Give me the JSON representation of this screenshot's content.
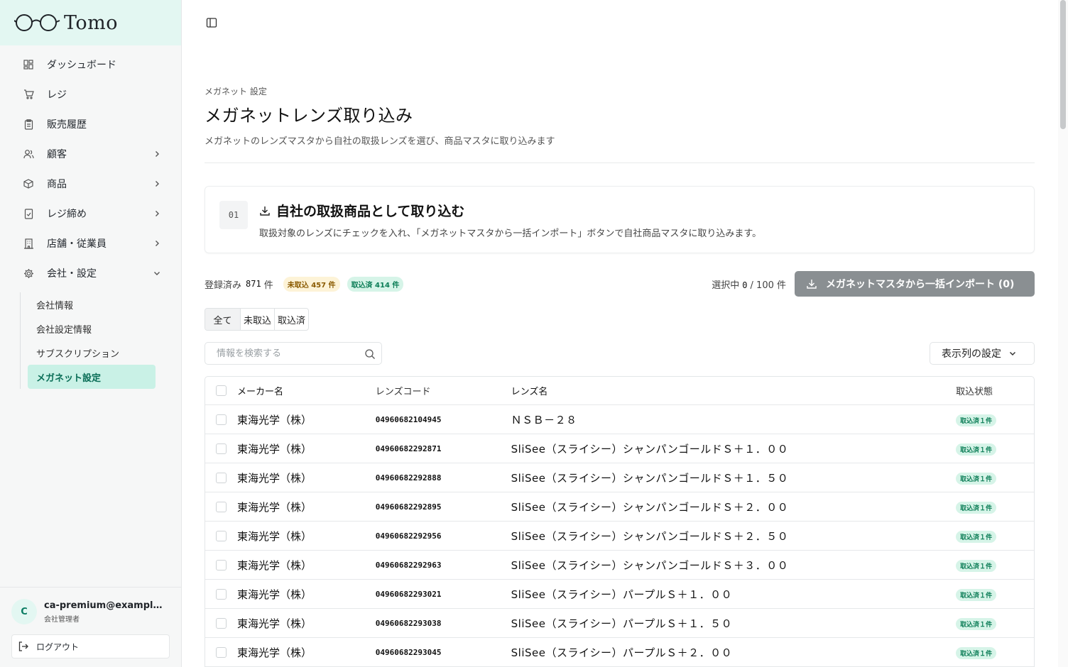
{
  "brand": {
    "name": "Tomo"
  },
  "sidebar": {
    "items": [
      {
        "label": "ダッシュボード",
        "icon": "dashboard-icon",
        "chevron": ""
      },
      {
        "label": "レジ",
        "icon": "cart-icon",
        "chevron": ""
      },
      {
        "label": "販売履歴",
        "icon": "receipt-icon",
        "chevron": ""
      },
      {
        "label": "顧客",
        "icon": "users-icon",
        "chevron": "right"
      },
      {
        "label": "商品",
        "icon": "box-icon",
        "chevron": "right"
      },
      {
        "label": "レジ締め",
        "icon": "register-close-icon",
        "chevron": "right"
      },
      {
        "label": "店舗・従業員",
        "icon": "store-icon",
        "chevron": "right"
      },
      {
        "label": "会社・設定",
        "icon": "gear-icon",
        "chevron": "down"
      }
    ],
    "subitems": [
      {
        "label": "会社情報",
        "active": false
      },
      {
        "label": "会社設定情報",
        "active": false
      },
      {
        "label": "サブスクリプション",
        "active": false
      },
      {
        "label": "メガネット設定",
        "active": true
      }
    ],
    "user": {
      "initial": "C",
      "email": "ca-premium@example.com",
      "role": "会社管理者"
    },
    "logout_label": "ログアウト"
  },
  "page": {
    "breadcrumb": "メガネット 設定",
    "title": "メガネットレンズ取り込み",
    "description": "メガネットのレンズマスタから自社の取扱レンズを選び、商品マスタに取り込みます"
  },
  "step": {
    "number": "01",
    "title": "自社の取扱商品として取り込む",
    "description": "取扱対象のレンズにチェックを入れ、「メガネットマスタから一括インポート」ボタンで自社商品マスタに取り込みます。"
  },
  "stats": {
    "registered_label": "登録済み",
    "registered_count": "871",
    "unit": "件",
    "pending_badge": "未取込 457 件",
    "imported_badge": "取込済 414 件",
    "selected_label": "選択中",
    "selected_count": "0",
    "selected_max": "/ 100 件",
    "import_button": "メガネットマスタから一括インポート (0)"
  },
  "filters": {
    "tabs": [
      "全て",
      "未取込",
      "取込済"
    ],
    "active": 0
  },
  "search": {
    "placeholder": "情報を検索する"
  },
  "columns_button": "表示列の設定",
  "table": {
    "headers": {
      "maker": "メーカー名",
      "code": "レンズコード",
      "name": "レンズ名",
      "status": "取込状態"
    },
    "rows": [
      {
        "maker": "東海光学（株）",
        "code": "04960682104945",
        "name": "ＮＳＢ－２８",
        "status": "取込済１件"
      },
      {
        "maker": "東海光学（株）",
        "code": "04960682292871",
        "name": "SliSee（スライシー）シャンパンゴールドＳ＋１．００",
        "status": "取込済１件"
      },
      {
        "maker": "東海光学（株）",
        "code": "04960682292888",
        "name": "SliSee（スライシー）シャンパンゴールドＳ＋１．５０",
        "status": "取込済１件"
      },
      {
        "maker": "東海光学（株）",
        "code": "04960682292895",
        "name": "SliSee（スライシー）シャンパンゴールドＳ＋２．００",
        "status": "取込済１件"
      },
      {
        "maker": "東海光学（株）",
        "code": "04960682292956",
        "name": "SliSee（スライシー）シャンパンゴールドＳ＋２．５０",
        "status": "取込済１件"
      },
      {
        "maker": "東海光学（株）",
        "code": "04960682292963",
        "name": "SliSee（スライシー）シャンパンゴールドＳ＋３．００",
        "status": "取込済１件"
      },
      {
        "maker": "東海光学（株）",
        "code": "04960682293021",
        "name": "SliSee（スライシー）パープルＳ＋１．００",
        "status": "取込済１件"
      },
      {
        "maker": "東海光学（株）",
        "code": "04960682293038",
        "name": "SliSee（スライシー）パープルＳ＋１．５０",
        "status": "取込済１件"
      },
      {
        "maker": "東海光学（株）",
        "code": "04960682293045",
        "name": "SliSee（スライシー）パープルＳ＋２．００",
        "status": "取込済１件"
      }
    ]
  },
  "colors": {
    "accent": "#c9f1e6",
    "brand_bg": "#e3f7f2",
    "import_button": "#8a8f92",
    "imported_badge": "#d6f4e8",
    "pending_badge": "#fdf3d7"
  }
}
